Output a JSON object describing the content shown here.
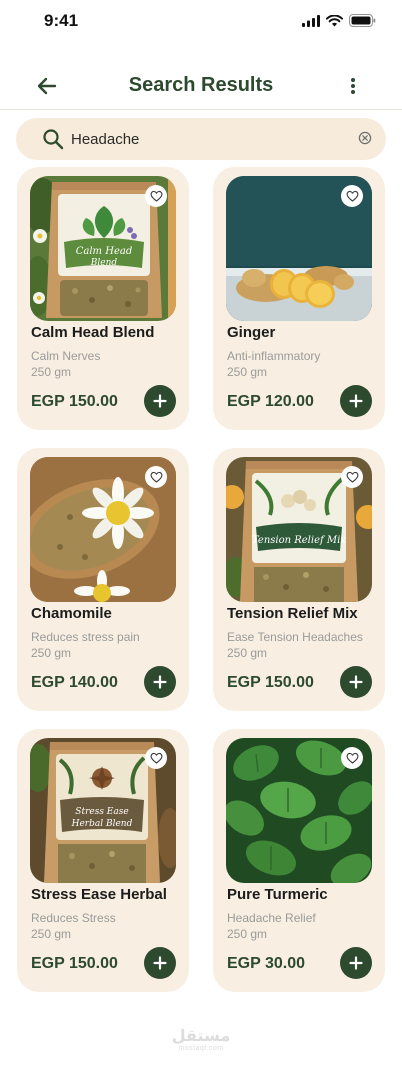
{
  "status_bar": {
    "time": "9:41"
  },
  "header": {
    "title": "Search Results"
  },
  "search": {
    "value": "Headache"
  },
  "colors": {
    "brand_green": "#2d4a2f",
    "card_bg": "#f8efe2",
    "search_bg": "#f7ecdc"
  },
  "products": [
    {
      "name": "Calm Head Blend",
      "description": "Calm Nerves",
      "weight": "250 gm",
      "price": "EGP 150.00",
      "pouch_label_line1": "Calm Head",
      "pouch_label_line2": "Blend"
    },
    {
      "name": "Ginger",
      "description": "Anti-inflammatory",
      "weight": "250 gm",
      "price": "EGP 120.00"
    },
    {
      "name": "Chamomile",
      "description": "Reduces stress pain",
      "weight": "250 gm",
      "price": "EGP 140.00"
    },
    {
      "name": "Tension Relief Mix",
      "description": "Ease Tension Headaches",
      "weight": "250 gm",
      "price": "EGP 150.00",
      "pouch_label_line1": "Tension Relief Mix"
    },
    {
      "name": "Stress Ease Herbal",
      "description": "Reduces Stress",
      "weight": "250 gm",
      "price": "EGP 150.00",
      "pouch_label_line1": "Stress Ease",
      "pouch_label_line2": "Herbal Blend"
    },
    {
      "name": "Pure Turmeric",
      "description": "Headache Relief",
      "weight": "250 gm",
      "price": "EGP 30.00"
    }
  ],
  "icons": {
    "back": "arrow-left-icon",
    "more": "more-vertical-icon",
    "search": "search-icon",
    "clear": "clear-circle-icon",
    "favorite": "heart-icon",
    "add": "plus-icon"
  },
  "watermark": {
    "logo": "مستقل",
    "site": "mostaql.com"
  }
}
